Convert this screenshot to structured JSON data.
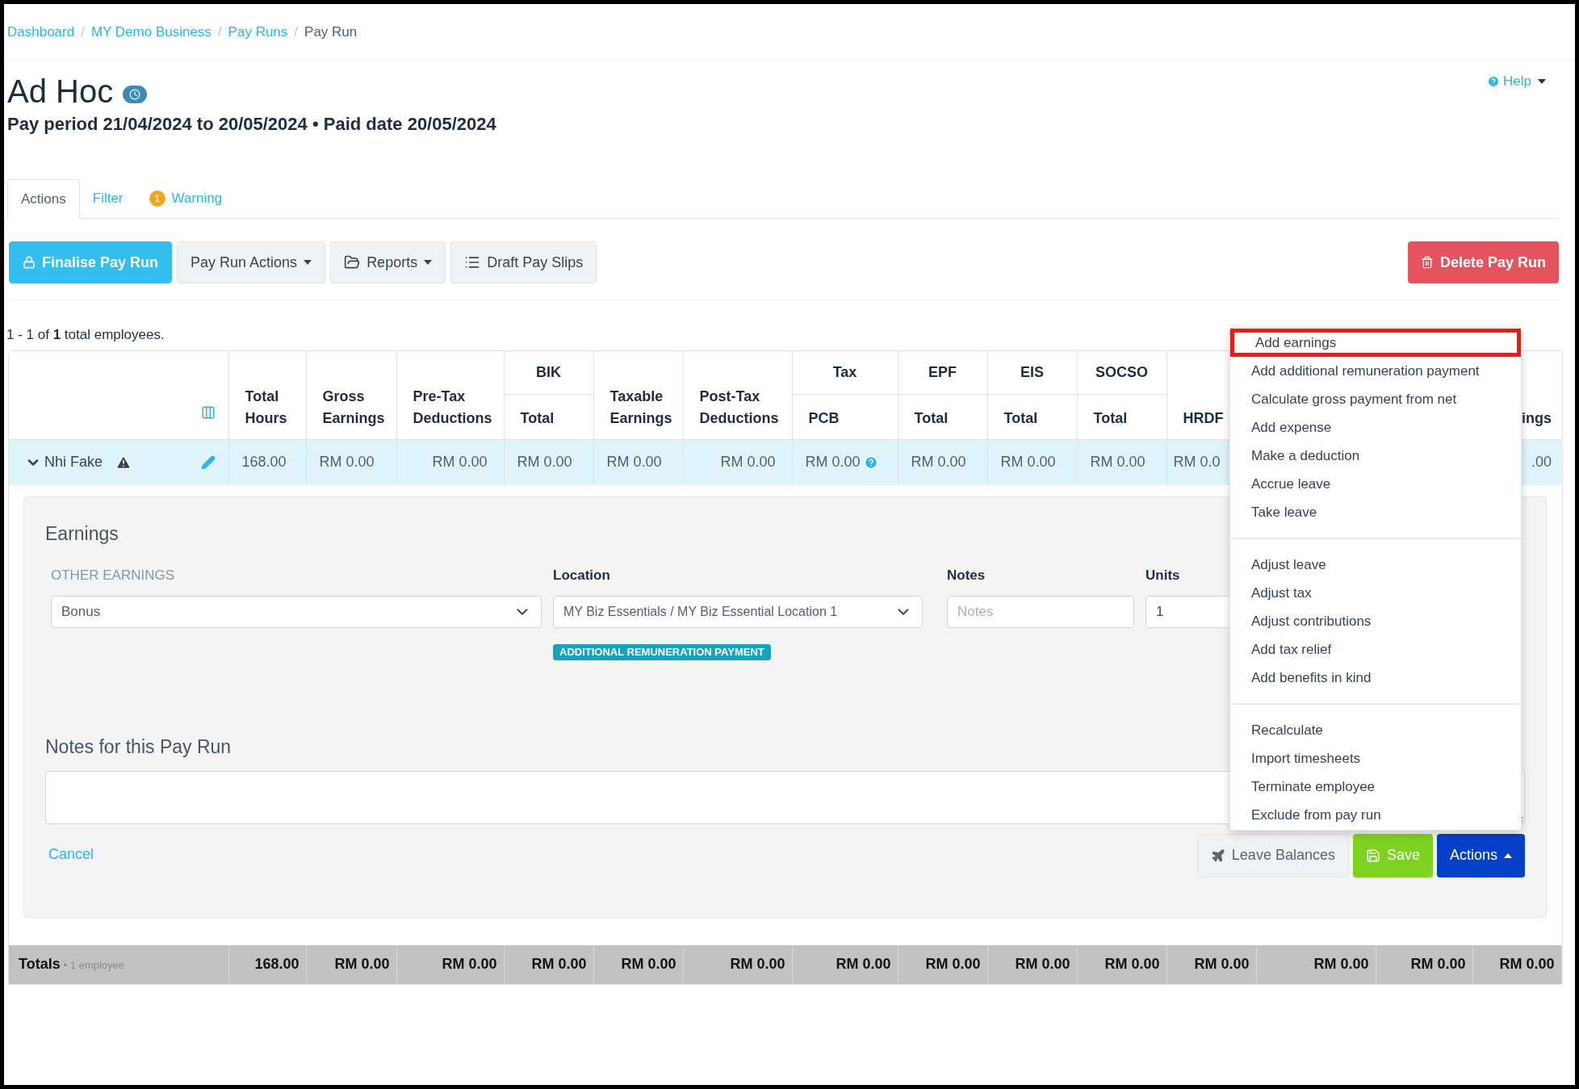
{
  "breadcrumb": [
    {
      "label": "Dashboard",
      "link": true
    },
    {
      "label": "MY Demo Business",
      "link": true
    },
    {
      "label": "Pay Runs",
      "link": true
    },
    {
      "label": "Pay Run",
      "link": false
    }
  ],
  "breadcrumb_separator": "/",
  "help": {
    "label": "Help"
  },
  "title": "Ad Hoc",
  "subtitle": "Pay period 21/04/2024 to 20/05/2024 • Paid date 20/05/2024",
  "tabs": [
    {
      "label": "Actions",
      "selected": true
    },
    {
      "label": "Filter",
      "selected": false
    },
    {
      "label": "Warning",
      "selected": false,
      "badge": "1"
    }
  ],
  "toolbar": [
    {
      "label": "Finalise Pay Run",
      "kind": "primary"
    },
    {
      "label": "Pay Run Actions",
      "kind": "dropdown"
    },
    {
      "label": "Reports",
      "kind": "dropdown"
    },
    {
      "label": "Draft Pay Slips",
      "kind": "plain"
    }
  ],
  "delete_button": {
    "label": "Delete Pay Run"
  },
  "summary": "1 - 1 of **1** total employees.",
  "table": {
    "columns": [
      {
        "label": "Total Hours"
      },
      {
        "label": "Gross Earnings"
      },
      {
        "label": "Pre-Tax Deductions"
      },
      {
        "group": "BIK",
        "label": "Total"
      },
      {
        "label": "Taxable Earnings"
      },
      {
        "label": "Post-Tax Deductions"
      },
      {
        "group": "Tax",
        "label": "PCB"
      },
      {
        "group": "EPF",
        "label": "Total"
      },
      {
        "group": "EIS",
        "label": "Total"
      },
      {
        "group": "SOCSO",
        "label": "Total"
      },
      {
        "label": "HRDF"
      }
    ],
    "last_column": {
      "label": "ings"
    },
    "row": {
      "name": "Nhi Fake",
      "expanded": true,
      "values": [
        "168.00",
        "RM 0.00",
        "RM 0.00",
        "RM 0.00",
        "RM 0.00",
        "RM 0.00",
        "RM 0.00",
        "RM 0.00",
        "RM 0.00",
        "RM 0.00",
        "RM 0.0"
      ],
      "last_value": ".00"
    },
    "totals": {
      "label": "Totals",
      "count": "• 1 employee",
      "values": [
        "168.00",
        "RM 0.00",
        "RM 0.00",
        "RM 0.00",
        "RM 0.00",
        "RM 0.00",
        "RM 0.00",
        "RM 0.00",
        "RM 0.00",
        "RM 0.00",
        "RM 0.00",
        "RM 0.00",
        "RM 0.00",
        "RM 0.00"
      ]
    }
  },
  "earnings": {
    "title": "Earnings",
    "labels": [
      "OTHER EARNINGS",
      "Location",
      "Notes",
      "Units"
    ],
    "type": "Bonus",
    "location": "MY Biz Essentials / MY Biz Essential Location 1",
    "notes_placeholder": "Notes",
    "units": "1",
    "tag": "ADDITIONAL REMUNERATION PAYMENT"
  },
  "notes": {
    "title": "Notes for this Pay Run"
  },
  "cancel": "Cancel",
  "footer_buttons": [
    {
      "label": "Leave Balances",
      "kind": "light"
    },
    {
      "label": "Save",
      "kind": "success"
    },
    {
      "label": "Actions",
      "kind": "menu"
    }
  ],
  "menu": [
    [
      {
        "label": "Add earnings",
        "highlighted": true
      },
      {
        "label": "Add additional remuneration payment",
        "highlighted": false
      },
      {
        "label": "Calculate gross payment from net",
        "highlighted": false
      },
      {
        "label": "Add expense",
        "highlighted": false
      },
      {
        "label": "Make a deduction",
        "highlighted": false
      },
      {
        "label": "Accrue leave",
        "highlighted": false
      },
      {
        "label": "Take leave",
        "highlighted": false
      }
    ],
    [
      {
        "label": "Adjust leave",
        "highlighted": false
      },
      {
        "label": "Adjust tax",
        "highlighted": false
      },
      {
        "label": "Adjust contributions",
        "highlighted": false
      },
      {
        "label": "Add tax relief",
        "highlighted": false
      },
      {
        "label": "Add benefits in kind",
        "highlighted": false
      }
    ],
    [
      {
        "label": "Recalculate",
        "highlighted": false
      },
      {
        "label": "Import timesheets",
        "highlighted": false
      },
      {
        "label": "Terminate employee",
        "highlighted": false
      },
      {
        "label": "Exclude from pay run",
        "highlighted": false
      }
    ]
  ]
}
